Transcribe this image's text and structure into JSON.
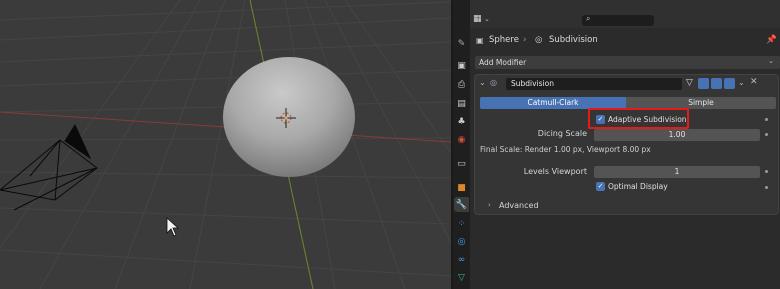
{
  "colors": {
    "accent": "#4772b3",
    "highlight_box": "#e31b1b",
    "x_axis": "#8a3a3a",
    "y_axis": "#6b8a2a"
  },
  "viewport": {
    "objects": [
      "sphere",
      "camera"
    ],
    "cursor_icon": "mouse-pointer-icon"
  },
  "tabs": [
    {
      "name": "tool-icon"
    },
    {
      "name": "render-icon"
    },
    {
      "name": "output-icon"
    },
    {
      "name": "view-layer-icon"
    },
    {
      "name": "scene-icon"
    },
    {
      "name": "world-icon"
    },
    {
      "name": "collection-icon"
    },
    {
      "name": "object-icon"
    },
    {
      "name": "modifier-icon"
    },
    {
      "name": "particles-icon"
    },
    {
      "name": "physics-icon"
    },
    {
      "name": "constraints-icon"
    },
    {
      "name": "data-icon"
    }
  ],
  "breadcrumb": {
    "object": "Sphere",
    "separator": "›",
    "modifier": "Subdivision"
  },
  "add_modifier": {
    "label": "Add Modifier"
  },
  "modifier": {
    "name": "Subdivision",
    "type_options": [
      "Catmull-Clark",
      "Simple"
    ],
    "selected_type": "Catmull-Clark",
    "adaptive_subdivision": {
      "label": "Adaptive Subdivision",
      "checked": true
    },
    "dicing_scale": {
      "label": "Dicing Scale",
      "value": "1.00"
    },
    "final_scale": "Final Scale: Render 1.00 px, Viewport 8.00 px",
    "levels_viewport": {
      "label": "Levels Viewport",
      "value": "1"
    },
    "optimal_display": {
      "label": "Optimal Display",
      "checked": true
    },
    "advanced": {
      "label": "Advanced",
      "expanded": false
    }
  }
}
